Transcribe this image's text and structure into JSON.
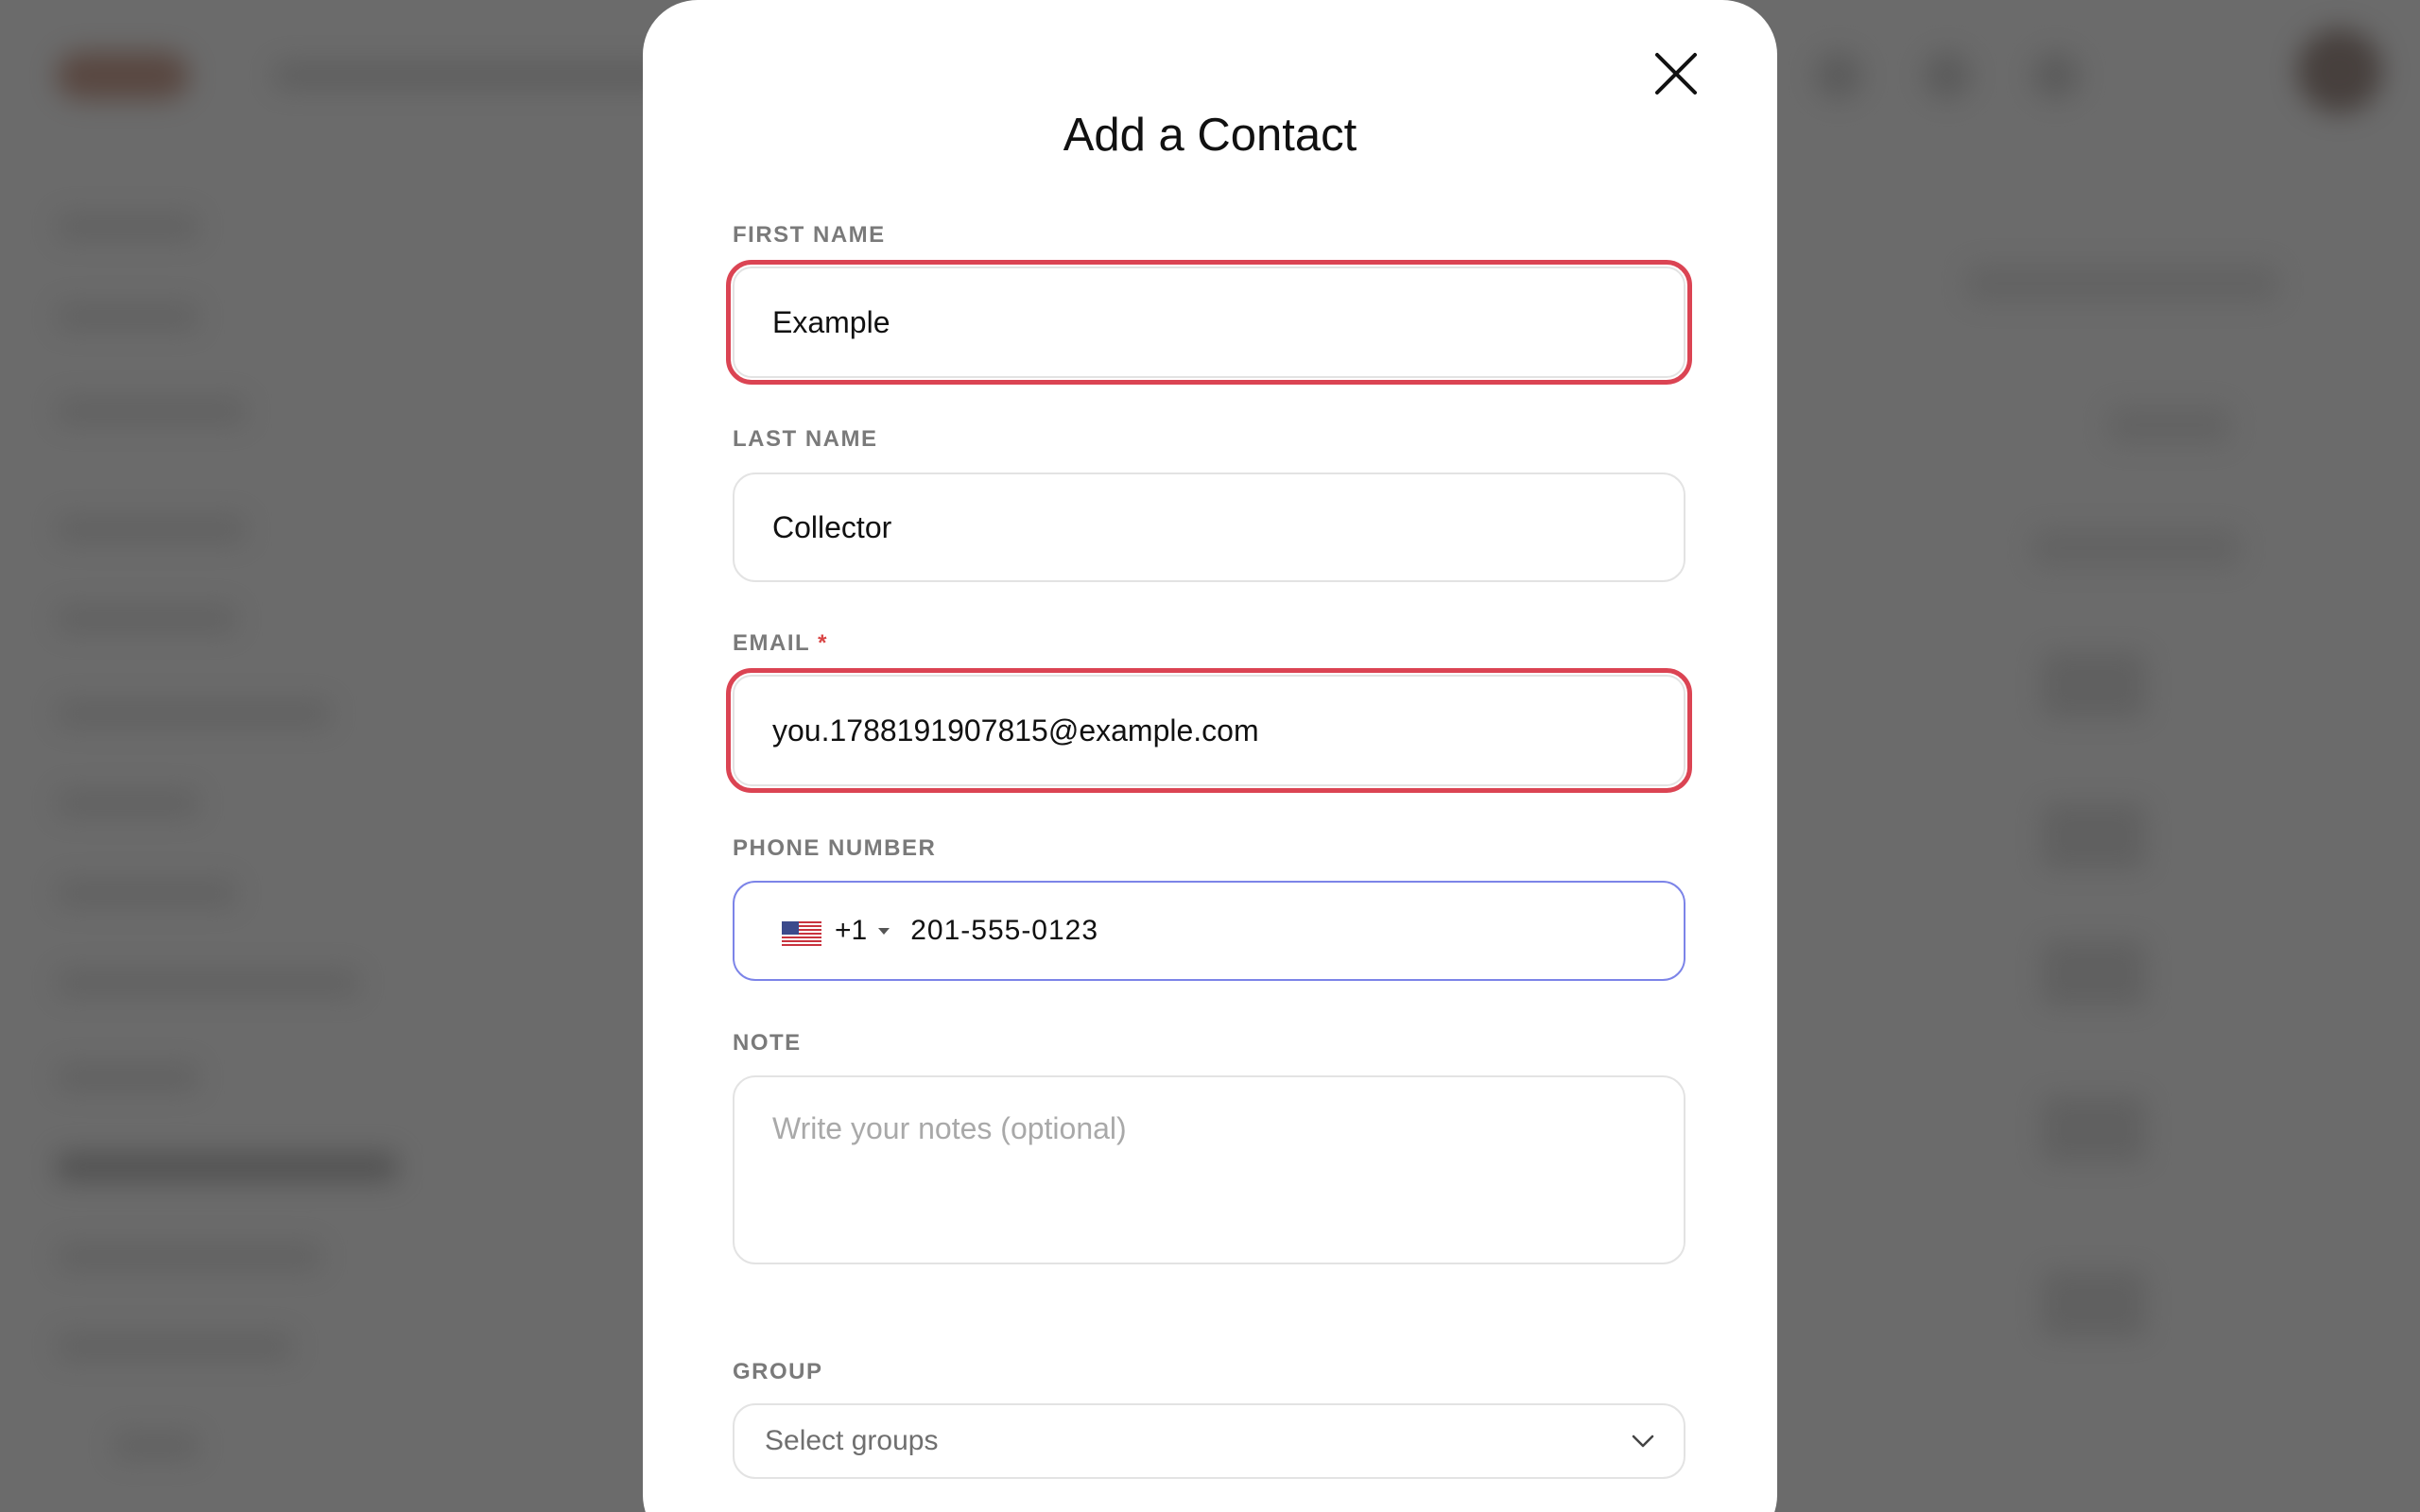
{
  "modal": {
    "title": "Add a Contact",
    "close_icon": "close-icon"
  },
  "fields": {
    "first_name": {
      "label": "FIRST NAME",
      "value": "Example"
    },
    "last_name": {
      "label": "LAST NAME",
      "value": "Collector"
    },
    "email": {
      "label": "EMAIL",
      "required_mark": "*",
      "value": "you.1788191907815@example.com"
    },
    "phone": {
      "label": "PHONE NUMBER",
      "country_flag": "us-flag-icon",
      "country_code": "+1",
      "value": "201-555-0123"
    },
    "note": {
      "label": "NOTE",
      "placeholder": "Write your notes (optional)",
      "value": ""
    },
    "group": {
      "label": "GROUP",
      "placeholder": "Select groups",
      "dropdown_icon": "chevron-down-icon"
    }
  },
  "colors": {
    "error_outline": "#db4453",
    "focus_border": "#7c84e8",
    "label_gray": "#7a7a7a",
    "required_red": "#d94545",
    "overlay": "#6b6b6b"
  }
}
